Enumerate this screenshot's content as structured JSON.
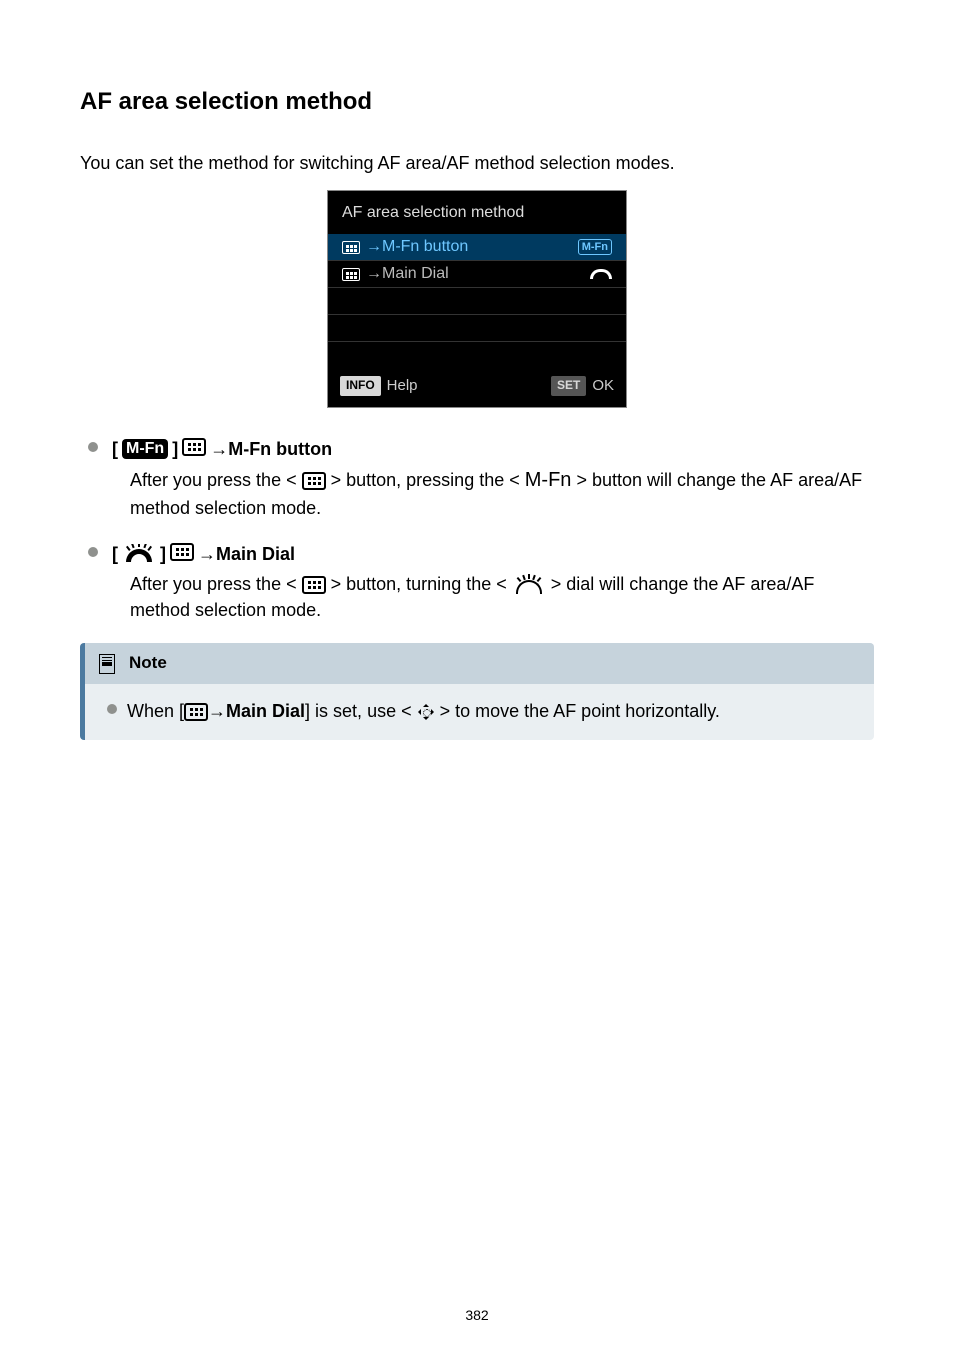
{
  "title": "AF area selection method",
  "intro": "You can set the method for switching AF area/AF method selection modes.",
  "screenshot": {
    "title": "AF area selection method",
    "row1_label": "→M-Fn button",
    "row1_badge": "M-Fn",
    "row2_label": "→Main Dial",
    "info_pill": "INFO",
    "help_label": "Help",
    "set_pill": "SET",
    "ok_label": "OK"
  },
  "opt_mfn": {
    "head_badge": "M-Fn",
    "head_label": "→M-Fn button",
    "body_1": "After you press the < ",
    "body_2": " > button, pressing the < ",
    "mfn_text": "M-Fn",
    "body_3": " > button will change the AF area/AF method selection mode."
  },
  "opt_dial": {
    "head_label": "→Main Dial",
    "body_1": "After you press the < ",
    "body_2": " > button, turning the < ",
    "body_3": " > dial will change the AF area/AF method selection mode."
  },
  "note": {
    "title": "Note",
    "body_1": "When [",
    "body_2": "→",
    "body_bold": "Main Dial",
    "body_3": "] is set, use < ",
    "body_4": " > to move the AF point horizontally."
  },
  "page_number": "382"
}
